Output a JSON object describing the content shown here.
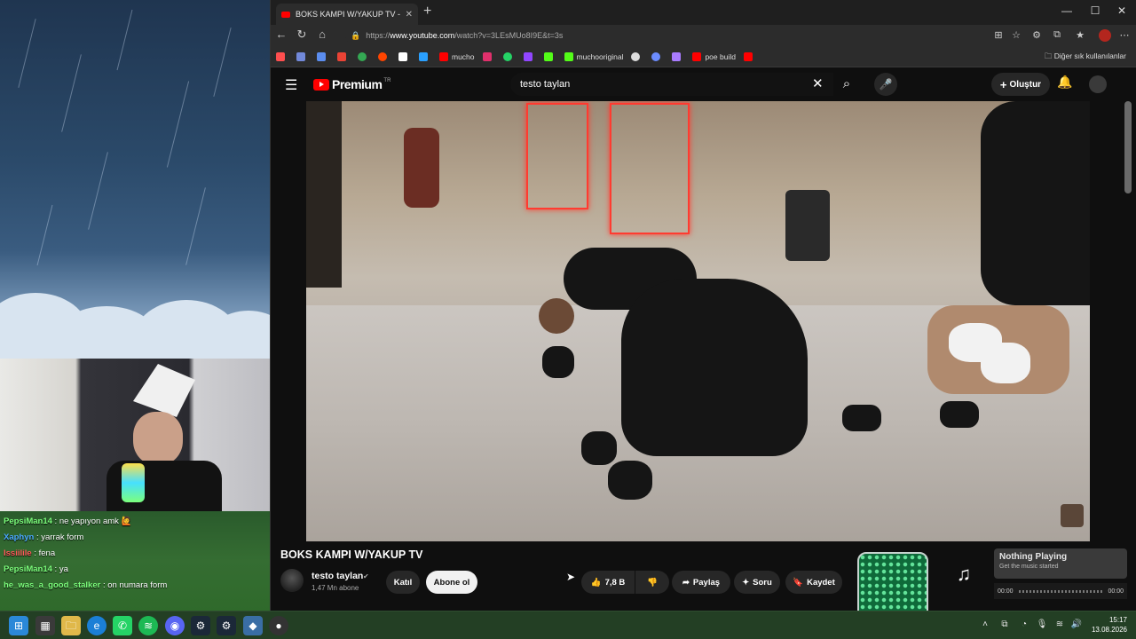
{
  "browser": {
    "tab_title": "BOKS KAMPI W/YAKUP TV - YouTube",
    "url_prefix": "https://",
    "url_domain": "www.youtube.com",
    "url_path": "/watch?v=3LEsMUo8I9E&t=3s",
    "bookmarks": [
      {
        "label": "",
        "color": "#ff4f4f"
      },
      {
        "label": "",
        "color": "#7289da"
      },
      {
        "label": "",
        "color": "#5b8def"
      },
      {
        "label": "",
        "color": "#ea4335"
      },
      {
        "label": "",
        "color": "#34a853"
      },
      {
        "label": "",
        "color": "#ff4500"
      },
      {
        "label": "",
        "color": "#ffffff"
      },
      {
        "label": "",
        "color": "#2aa0ff"
      },
      {
        "label": "mucho",
        "color": "#ff0000"
      },
      {
        "label": "",
        "color": "#e1306c"
      },
      {
        "label": "",
        "color": "#25d366"
      },
      {
        "label": "",
        "color": "#9146ff"
      },
      {
        "label": "",
        "color": "#53fc18"
      },
      {
        "label": "muchooriginal",
        "color": "#53fc18"
      },
      {
        "label": "",
        "color": "#dddddd"
      },
      {
        "label": "",
        "color": "#6c8cff"
      },
      {
        "label": "",
        "color": "#a97cff"
      },
      {
        "label": "poe build",
        "color": "#ff0000"
      },
      {
        "label": "",
        "color": "#ff0000"
      }
    ],
    "other_bookmarks": "Diğer sık kullanılanlar"
  },
  "youtube": {
    "logo_text": "Premium",
    "logo_region": "TR",
    "search_value": "testo taylan",
    "create_label": "Oluştur",
    "video_title": "BOKS KAMPI W/YAKUP TV",
    "channel_name": "testo taylan",
    "subscribers": "1,47 Mn abone",
    "join_label": "Katıl",
    "subscribe_label": "Abone ol",
    "like_count": "7,8 B",
    "share_label": "Paylaş",
    "ask_label": "Soru",
    "save_label": "Kaydet"
  },
  "chat": [
    {
      "user": "PepsiMan14",
      "color": "#7cff7c",
      "message": "ne yapıyon amk 🙋"
    },
    {
      "user": "Xaphyn",
      "color": "#4aa8ff",
      "message": "yarrak form"
    },
    {
      "user": "Issiilile",
      "color": "#ff5a5a",
      "message": "fena"
    },
    {
      "user": "PepsiMan14",
      "color": "#7cff7c",
      "message": "ya"
    },
    {
      "user": "he_was_a_good_stalker",
      "color": "#7cff7c",
      "message": "on numara form"
    }
  ],
  "music": {
    "title": "Nothing Playing",
    "subtitle": "Get the music started",
    "elapsed": "00:00",
    "total": "00:00"
  },
  "taskbar": {
    "time": "15:17",
    "date": "13.08.2026"
  }
}
